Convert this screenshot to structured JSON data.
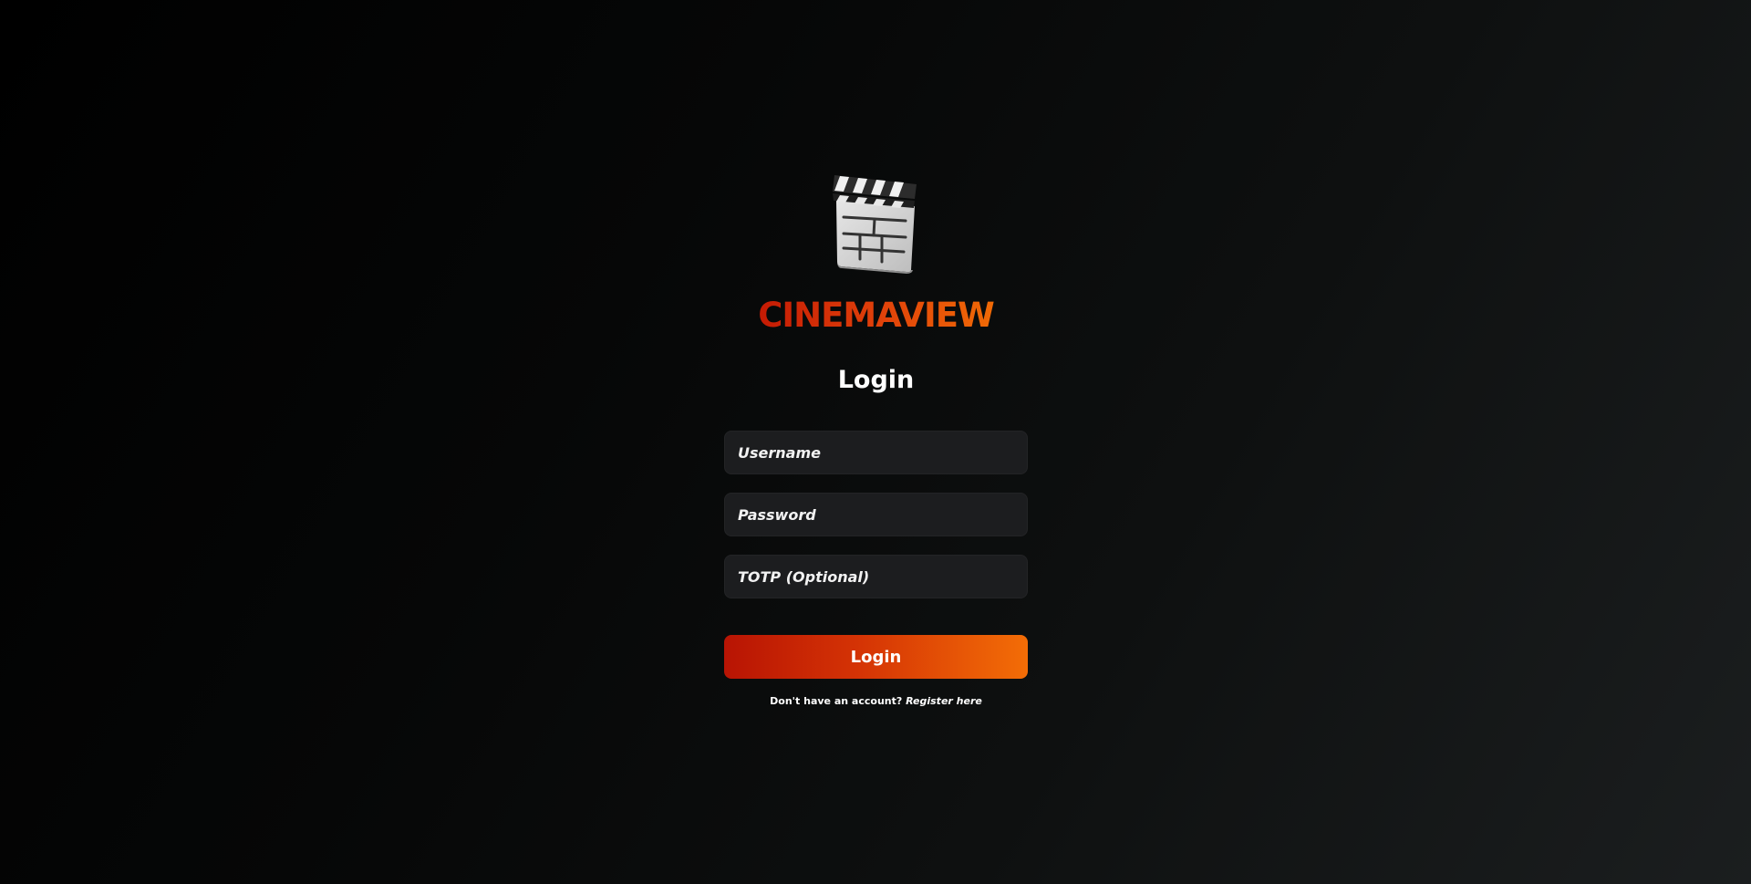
{
  "brand": {
    "name": "CINEMAVIEW",
    "logo_icon": "clapperboard-icon",
    "gradient_colors": [
      "#c41a04",
      "#f06a06"
    ]
  },
  "form": {
    "heading": "Login",
    "username_placeholder": "Username",
    "password_placeholder": "Password",
    "totp_placeholder": "TOTP (Optional)",
    "submit_label": "Login"
  },
  "register": {
    "prompt": "Don't have an account?",
    "link_label": "Register here"
  },
  "colors": {
    "accent_start": "#b81404",
    "accent_end": "#f36d06",
    "input_background": "#1c1d1f"
  }
}
